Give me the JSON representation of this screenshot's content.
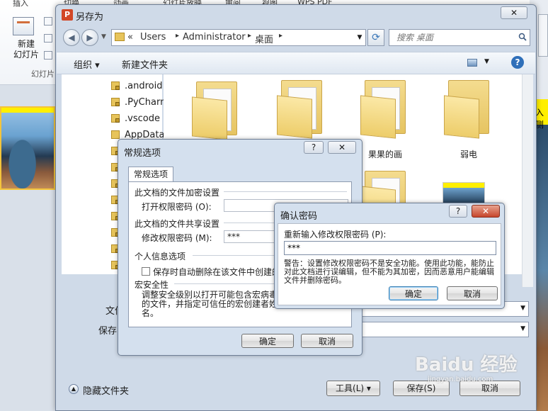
{
  "ppt": {
    "tabs": [
      "插入",
      "切换",
      "动画",
      "幻灯片放映",
      "审阅",
      "视图",
      "WPS PDF"
    ],
    "new_slide_label": "新建\n幻灯片",
    "group_label": "幻灯片",
    "right_text": "入侧"
  },
  "save_dialog": {
    "title": "另存为",
    "app_icon_letter": "P",
    "close_glyph": "✕",
    "address": {
      "prefix": "«",
      "crumbs": [
        "Users",
        "Administrator",
        "桌面"
      ]
    },
    "search_placeholder": "搜索 桌面",
    "toolbar": {
      "organize": "组织 ▾",
      "new_folder": "新建文件夹"
    },
    "nav_items": [
      ".android",
      ".PyCharm",
      ".vscode",
      "AppData",
      "",
      "",
      "",
      "",
      "",
      "",
      "",
      ""
    ],
    "files": [
      {
        "label": ""
      },
      {
        "label": ""
      },
      {
        "label": "果果的画"
      },
      {
        "label": "弱电"
      }
    ],
    "filename_label": "文件",
    "filetype_label": "保存",
    "hide_folders": "隐藏文件夹",
    "tools_button": "工具(L)",
    "save_button": "保存(S)",
    "cancel_button": "取消"
  },
  "options_dialog": {
    "title": "常规选项",
    "tab": "常规选项",
    "section_encrypt": "此文档的文件加密设置",
    "open_password_label": "打开权限密码 (O):",
    "open_password_value": "",
    "section_share": "此文档的文件共享设置",
    "modify_password_label": "修改权限密码 (M):",
    "modify_password_value": "***",
    "section_privacy": "个人信息选项",
    "privacy_checkbox_label": "保存时自动删除在该文件中创建的",
    "section_macro": "宏安全性",
    "macro_text": "调整安全级别以打开可能包含宏病毒的文件，并指定可信任的宏创建者姓名。",
    "ok": "确定",
    "cancel": "取消"
  },
  "confirm_dialog": {
    "title": "确认密码",
    "help_glyph": "?",
    "close_glyph": "✕",
    "prompt": "重新输入修改权限密码 (P):",
    "value": "***",
    "warning": "警告：设置修改权限密码不是安全功能。使用此功能，能防止对此文档进行误编辑，但不能为其加密，因而恶意用户能编辑文件并删除密码。",
    "ok": "确定",
    "cancel": "取消"
  },
  "watermark": {
    "main": "Baidu 经验",
    "sub": "jingyan.baidu.com"
  }
}
